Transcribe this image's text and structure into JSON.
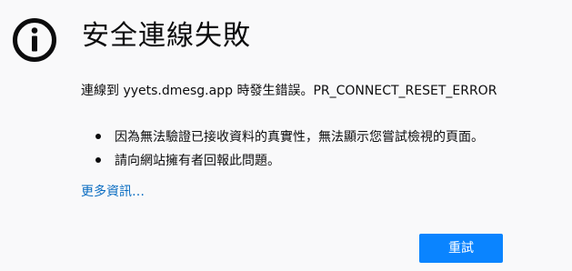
{
  "error": {
    "title": "安全連線失敗",
    "description": "連線到 yyets.dmesg.app 時發生錯誤。PR_CONNECT_RESET_ERROR",
    "reasons": [
      "因為無法驗證已接收資料的真實性，無法顯示您嘗試檢視的頁面。",
      "請向網站擁有者回報此問題。"
    ],
    "more_info_link": "更多資訊…",
    "retry_button": "重試",
    "icon": "info-icon"
  },
  "colors": {
    "background": "#f9f9fa",
    "link": "#0a6dc2",
    "button": "#0a84ff",
    "text": "#0c0c0d"
  }
}
